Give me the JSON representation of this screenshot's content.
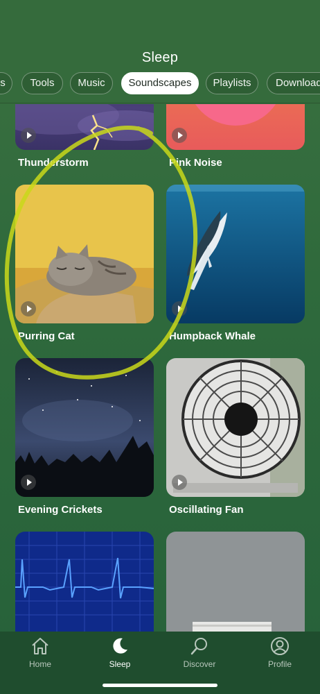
{
  "header": {
    "title": "Sleep"
  },
  "tabs": [
    {
      "label": "s"
    },
    {
      "label": "Tools"
    },
    {
      "label": "Music"
    },
    {
      "label": "Soundscapes"
    },
    {
      "label": "Playlists"
    },
    {
      "label": "Download"
    }
  ],
  "active_tab": "Soundscapes",
  "cards": [
    {
      "title": "Thunderstorm"
    },
    {
      "title": "Pink Noise"
    },
    {
      "title": "Purring Cat"
    },
    {
      "title": "Humpback Whale"
    },
    {
      "title": "Evening Crickets"
    },
    {
      "title": "Oscillating Fan"
    }
  ],
  "nav": [
    {
      "label": "Home",
      "icon": "home-icon"
    },
    {
      "label": "Sleep",
      "icon": "moon-icon"
    },
    {
      "label": "Discover",
      "icon": "discover-icon"
    },
    {
      "label": "Profile",
      "icon": "profile-icon"
    }
  ],
  "colors": {
    "background": "#2f6a3c",
    "tabbar": "#1f4d2e",
    "annotation": "#c9d81a"
  }
}
